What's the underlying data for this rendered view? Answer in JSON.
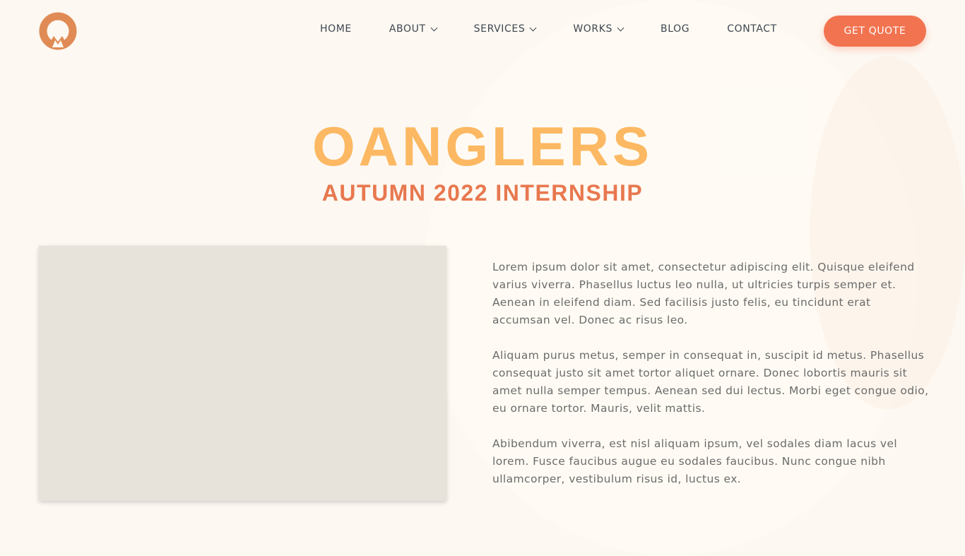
{
  "brand": {
    "logo_icon": "oanglers-ring-logo",
    "colors": {
      "logo": "#e08b55",
      "title": "#fcb862",
      "subtitle": "#e8784f",
      "button": "#f2734f"
    }
  },
  "nav": {
    "items": [
      {
        "label": "HOME",
        "dropdown": false
      },
      {
        "label": "ABOUT",
        "dropdown": true
      },
      {
        "label": "SERVICES",
        "dropdown": true
      },
      {
        "label": "WORKS",
        "dropdown": true
      },
      {
        "label": "BLOG",
        "dropdown": false
      },
      {
        "label": "CONTACT",
        "dropdown": false
      }
    ],
    "cta": "GET QUOTE"
  },
  "hero": {
    "title": "OANGLERS",
    "subtitle": "AUTUMN 2022 INTERNSHIP"
  },
  "content": {
    "paragraphs": [
      "Lorem ipsum dolor sit amet, consectetur adipiscing elit. Quisque eleifend varius viverra. Phasellus luctus leo nulla, ut ultricies turpis semper et. Aenean in eleifend diam. Sed facilisis justo felis, eu tincidunt erat accumsan vel. Donec ac risus leo.",
      "Aliquam purus metus, semper in consequat in, suscipit id metus. Phasellus consequat justo sit amet tortor aliquet ornare. Donec lobortis mauris sit amet nulla semper tempus. Aenean sed dui lectus. Morbi eget congue odio, eu ornare tortor. Mauris, velit mattis.",
      "Abibendum viverra, est nisl aliquam ipsum, vel sodales diam lacus vel lorem. Fusce faucibus augue eu sodales faucibus. Nunc congue nibh ullamcorper, vestibulum risus id, luctus ex."
    ]
  }
}
